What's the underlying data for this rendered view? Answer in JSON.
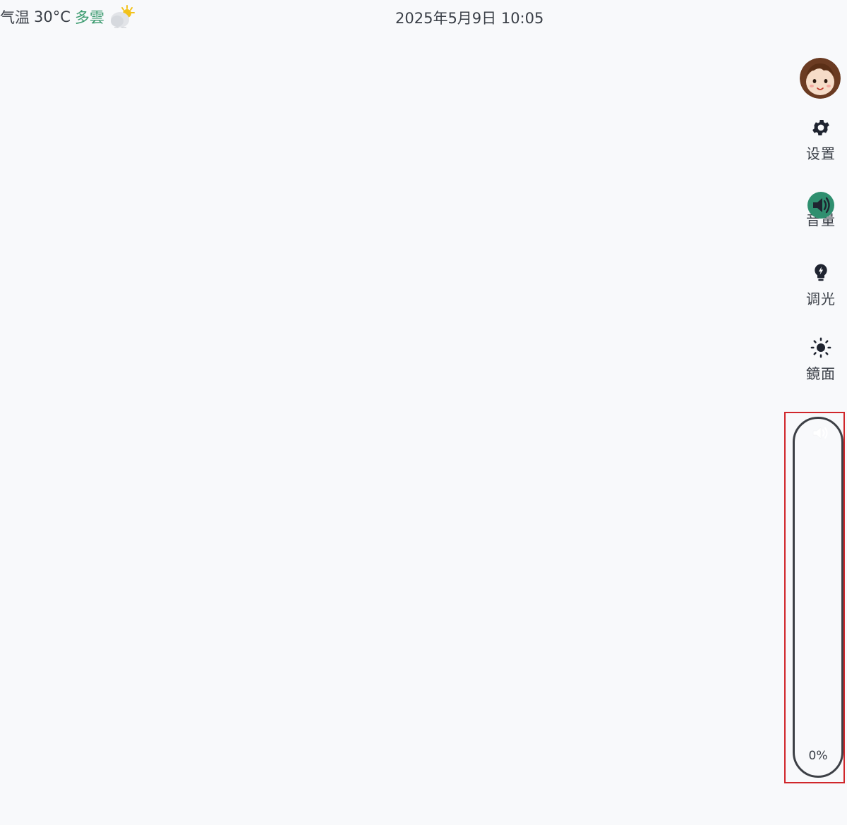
{
  "status_bar": {
    "weather_label": "气温",
    "temperature": "30°C",
    "condition": "多雲",
    "condition_color": "#3a9a6e",
    "weather_icon": "partly-cloudy-icon",
    "datetime": "2025年5月9日 10:05"
  },
  "side_menu": {
    "avatar_icon": "user-avatar",
    "items": [
      {
        "label": "设置",
        "icon": "gear-icon"
      },
      {
        "label": "音量",
        "icon": "speaker-icon",
        "active": true,
        "active_color": "#2f8f6f"
      },
      {
        "label": "调光",
        "icon": "lightbulb-icon"
      },
      {
        "label": "鏡面",
        "icon": "sun-icon"
      }
    ]
  },
  "volume_slider": {
    "icon": "speaker-icon",
    "value_text": "0%",
    "level": 0,
    "highlight_color": "#d0262b"
  }
}
